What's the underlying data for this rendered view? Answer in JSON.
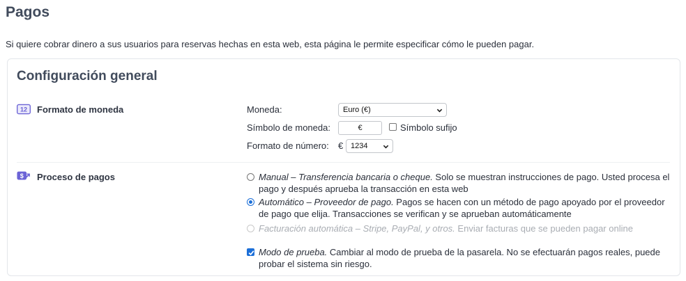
{
  "page": {
    "title": "Pagos",
    "description": "Si quiere cobrar dinero a sus usuarios para reservas hechas en esta web, esta página le permite especificar cómo le pueden pagar."
  },
  "card": {
    "title": "Configuración general"
  },
  "currency_format": {
    "icon": "number-12-icon",
    "icon_text": "12",
    "label": "Formato de moneda",
    "currency_label": "Moneda:",
    "currency_value": "Euro (€)",
    "symbol_label": "Símbolo de moneda:",
    "symbol_value": "€",
    "suffix_checked": false,
    "suffix_label": "Símbolo sufijo",
    "number_format_label": "Formato de número:",
    "number_format_prefix": "€",
    "number_format_value": "1234"
  },
  "payment_process": {
    "icon": "payment-flow-icon",
    "label": "Proceso de pagos",
    "options": [
      {
        "name": "Manual – Transferencia bancaria o cheque.",
        "desc": " Solo se muestran instrucciones de pago. Usted procesa el pago y después aprueba la transacción en esta web",
        "checked": false,
        "disabled": false
      },
      {
        "name": "Automático – Proveedor de pago.",
        "desc": " Pagos se hacen con un método de pago apoyado por el proveedor de pago que elija. Transacciones se verifican y se aprueban automáticamente",
        "checked": true,
        "disabled": false
      },
      {
        "name": "Facturación automática – Stripe, PayPal, y otros.",
        "desc": " Enviar facturas que se pueden pagar online",
        "checked": false,
        "disabled": true
      }
    ],
    "test_mode": {
      "checked": true,
      "name": "Modo de prueba.",
      "desc": " Cambiar al modo de prueba de la pasarela. No se efectuarán pagos reales, puede probar el sistema sin riesgo."
    }
  },
  "colors": {
    "accent": "#1c6fd8",
    "icon": "#6b63d6",
    "heading": "#414b5c",
    "muted": "#a9adb3"
  }
}
